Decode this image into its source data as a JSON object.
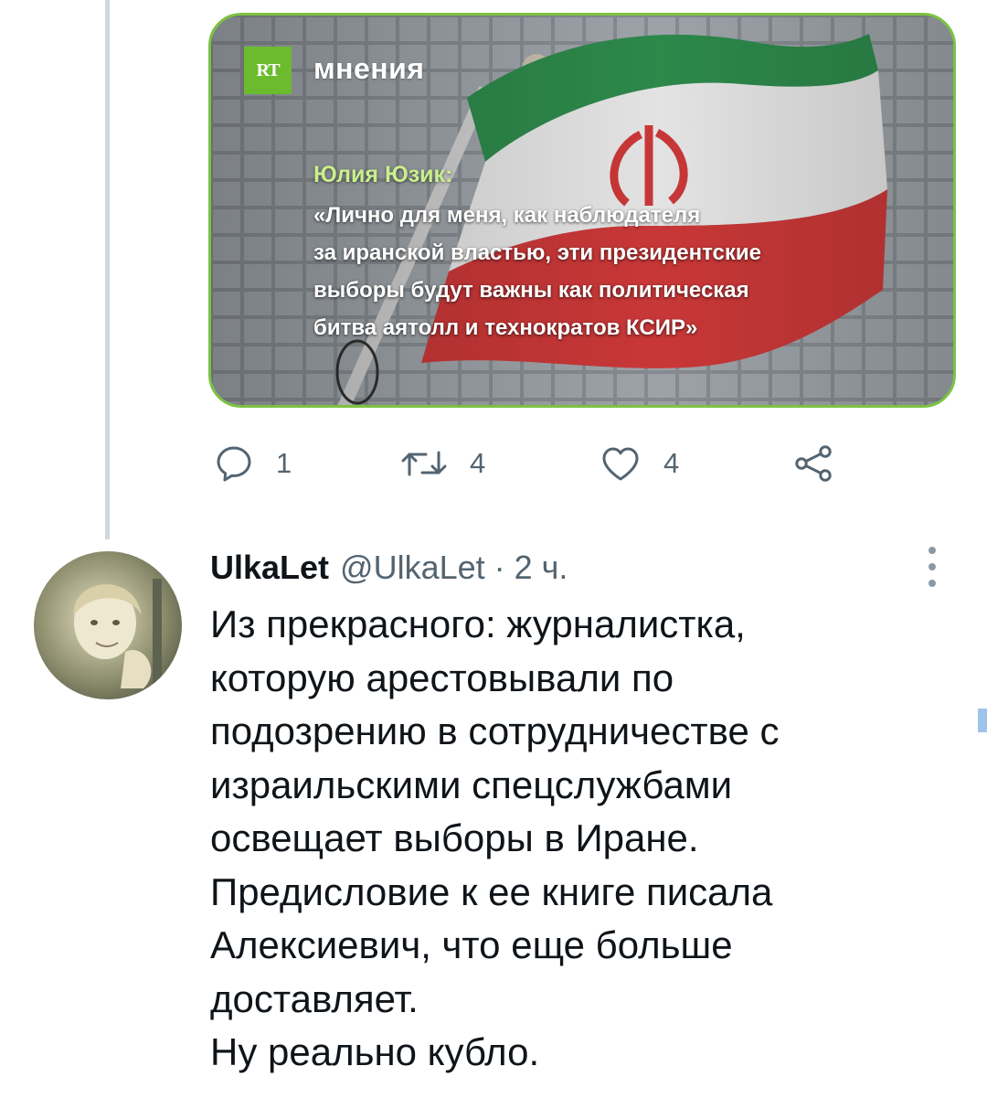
{
  "media_card": {
    "logo_text": "RT",
    "section": "мнения",
    "author": "Юлия Юзик:",
    "quote_lines": [
      "«Лично для меня, как наблюдателя",
      "за иранской властью, эти президентские",
      "выборы будут важны как политическая",
      "битва аятолл и технократов КСИР»"
    ],
    "accent_color": "#7cc242"
  },
  "actions": {
    "reply_count": "1",
    "retweet_count": "4",
    "like_count": "4"
  },
  "reply": {
    "display_name": "UlkaLet",
    "handle": "@UlkaLet",
    "separator": "·",
    "time": "2 ч.",
    "body_lines": [
      "Из прекрасного: журналистка,",
      "которую арестовывали по",
      "подозрению в сотрудничестве с",
      "израильскими спецслужбами",
      "освещает выборы в Иране.",
      "Предисловие к ее книге писала",
      "Алексиевич, что еще больше",
      "доставляет.",
      "Ну реально кубло."
    ]
  },
  "icons": [
    "reply-icon",
    "retweet-icon",
    "like-icon",
    "share-icon",
    "more-options-icon"
  ]
}
